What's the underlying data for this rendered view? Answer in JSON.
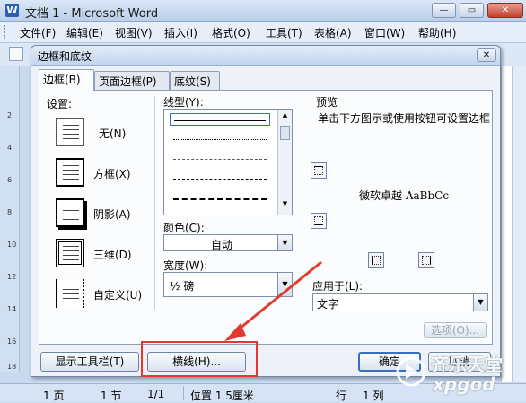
{
  "word": {
    "title": "文档 1 - Microsoft Word",
    "app_icon_letter": "W",
    "controls": {
      "minimize": "—",
      "restore": "▭",
      "close": "✕"
    },
    "menu": [
      "文件(F)",
      "编辑(E)",
      "视图(V)",
      "插入(I)",
      "格式(O)",
      "工具(T)",
      "表格(A)",
      "窗口(W)",
      "帮助(H)"
    ],
    "ruler_labels": [
      "2",
      "4",
      "6",
      "8",
      "10",
      "12",
      "14",
      "16",
      "18"
    ]
  },
  "dialog": {
    "title": "边框和底纹",
    "close_glyph": "✕",
    "tabs": [
      "边框(B)",
      "页面边框(P)",
      "底纹(S)"
    ],
    "settings": {
      "label": "设置:",
      "options": [
        "无(N)",
        "方框(X)",
        "阴影(A)",
        "三维(D)",
        "自定义(U)"
      ]
    },
    "line_style": {
      "label": "线型(Y):"
    },
    "color": {
      "label": "颜色(C):",
      "value": "自动"
    },
    "width": {
      "label": "宽度(W):",
      "value": "½ 磅"
    },
    "preview": {
      "label": "预览",
      "hint": "单击下方图示或使用按钮可设置边框",
      "sample_text": "微软卓越  AaBbCc"
    },
    "apply_to": {
      "label": "应用于(L):",
      "value": "文字"
    },
    "buttons": {
      "options": "选项(O)...",
      "show_toolbar": "显示工具栏(T)",
      "horizontal_line": "横线(H)...",
      "ok": "确定",
      "cancel": "取消"
    }
  },
  "status_bar": {
    "page": "1 页",
    "section": "1 节",
    "page_of": "1/1",
    "position": "位置 1.5厘米",
    "line": "行",
    "column": "1 列"
  },
  "watermark": {
    "text": "齐乐天堂",
    "site": "xpgod"
  },
  "colors": {
    "annotation": "#e23a2e",
    "dialog_border": "#6d87ad"
  }
}
